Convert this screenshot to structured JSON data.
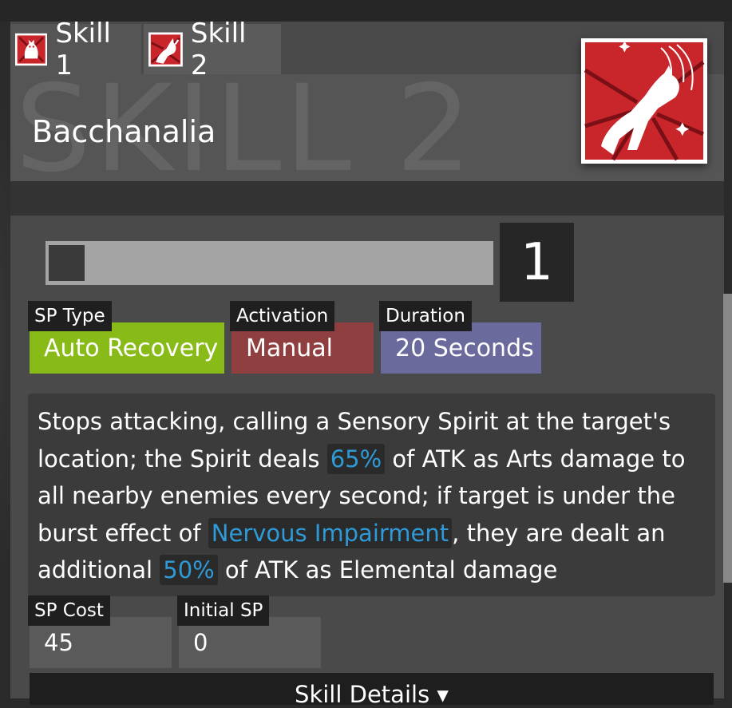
{
  "tabs": [
    {
      "label": "Skill 1",
      "icon": "cat-skill-icon"
    },
    {
      "label": "Skill 2",
      "icon": "cat-pounce-skill-icon"
    }
  ],
  "header": {
    "watermark": "SKILL 2",
    "skill_name": "Bacchanalia",
    "icon": "skill-2-large-icon"
  },
  "level": {
    "value": "1",
    "slider_fraction": 0.0
  },
  "tags": {
    "sp_type": {
      "label": "SP Type",
      "value": "Auto Recovery",
      "color": "#88bb18"
    },
    "activation": {
      "label": "Activation",
      "value": "Manual",
      "color": "#8f3f3f"
    },
    "duration": {
      "label": "Duration",
      "value": "20 Seconds",
      "color": "#6a6a9c"
    }
  },
  "description": {
    "part1": "Stops attacking, calling a Sensory Spirit at the target's location; the Spirit deals ",
    "hl1": "65%",
    "part2": " of ATK as Arts damage to all nearby enemies every second; if target is under the burst effect of ",
    "hl2": "Nervous Impairment",
    "part3": ", they are dealt an additional ",
    "hl3": "50%",
    "part4": " of ATK as Elemental damage"
  },
  "sp": {
    "cost_label": "SP Cost",
    "cost_value": "45",
    "initial_label": "Initial SP",
    "initial_value": "0"
  },
  "details_button": {
    "label": "Skill Details ▾"
  },
  "colors": {
    "accent_link": "#2f9ad8",
    "icon_red": "#c9262c"
  }
}
